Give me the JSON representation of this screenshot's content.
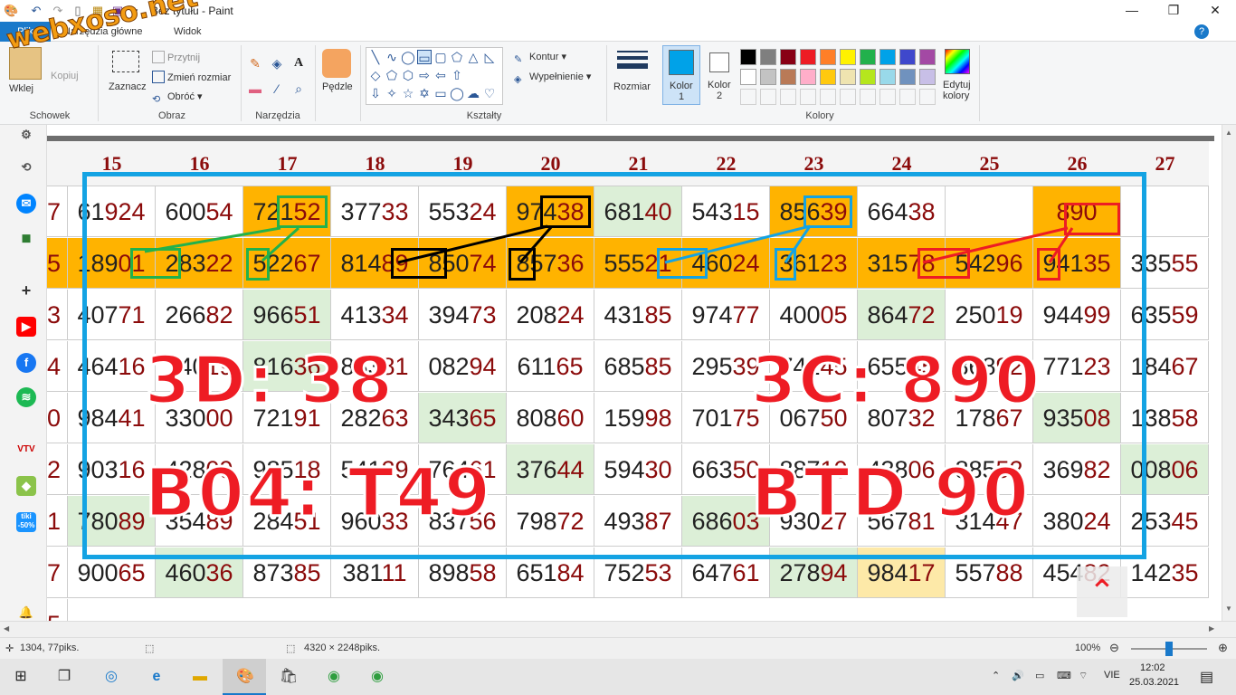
{
  "window": {
    "title": "Bez tytułu - Paint",
    "minimize": "—",
    "restore": "❐",
    "close": "✕"
  },
  "watermark": "webxoso.net",
  "menu": {
    "file": "Plik",
    "home": "Narzędzia główne",
    "view": "Widok",
    "help": "?"
  },
  "ribbon": {
    "clipboard": {
      "label": "Schowek",
      "paste": "Wklej",
      "copy": "Kopiuj"
    },
    "image": {
      "label": "Obraz",
      "select": "Zaznacz",
      "crop": "Przytnij",
      "resize": "Zmień rozmiar",
      "rotate": "Obróć"
    },
    "tools": {
      "label": "Narzędzia"
    },
    "brushes": {
      "label": "Pędzle"
    },
    "shapes": {
      "label": "Kształty",
      "outline": "Kontur",
      "fill": "Wypełnienie"
    },
    "size": {
      "label": "Rozmiar"
    },
    "color1": {
      "label": "Kolor",
      "num": "1"
    },
    "color2": {
      "label": "Kolor",
      "num": "2"
    },
    "edit_colors": {
      "label1": "Edytuj",
      "label2": "kolory"
    },
    "colors": {
      "label": "Kolory"
    },
    "palette_row1": [
      "#000000",
      "#7f7f7f",
      "#880015",
      "#ed1c24",
      "#ff7f27",
      "#fff200",
      "#22b14c",
      "#00a2e8",
      "#3f48cc",
      "#a349a4"
    ],
    "palette_row2": [
      "#ffffff",
      "#c3c3c3",
      "#b97a57",
      "#ffaec9",
      "#ffc90e",
      "#efe4b0",
      "#b5e61d",
      "#99d9ea",
      "#7092be",
      "#c8bfe7"
    ],
    "color1_value": "#00a2e8",
    "color2_value": "#ffffff"
  },
  "table": {
    "headers": [
      "15",
      "16",
      "17",
      "18",
      "19",
      "20",
      "21",
      "22",
      "23",
      "24",
      "25",
      "26",
      "27"
    ],
    "left_digits": [
      "7",
      "5",
      "3",
      "4",
      "0",
      "2",
      "1",
      "7",
      "5"
    ],
    "rows": [
      [
        [
          "61",
          "924",
          "",
          "orange_left_none"
        ],
        [
          "600",
          "54",
          ""
        ],
        [
          "721",
          "52",
          "orange"
        ],
        [
          "377",
          "33",
          ""
        ],
        [
          "553",
          "24",
          ""
        ],
        [
          "974",
          "38",
          "orange"
        ],
        [
          "681",
          "40",
          "green"
        ],
        [
          "543",
          "15",
          ""
        ],
        [
          "856",
          "39",
          "orange"
        ],
        [
          "664",
          "38",
          ""
        ],
        [
          "",
          "",
          ""
        ],
        [
          "",
          "890",
          "orange"
        ],
        [
          "",
          "",
          ""
        ]
      ],
      [
        [
          "189",
          "01",
          "orange"
        ],
        [
          "283",
          "22",
          "orange"
        ],
        [
          "522",
          "67",
          "orange"
        ],
        [
          "814",
          "89",
          "orange"
        ],
        [
          "850",
          "74",
          "orange"
        ],
        [
          "857",
          "36",
          "orange"
        ],
        [
          "555",
          "21",
          "orange"
        ],
        [
          "460",
          "24",
          "orange"
        ],
        [
          "361",
          "23",
          "orange"
        ],
        [
          "315",
          "78",
          "orange"
        ],
        [
          "542",
          "96",
          "orange"
        ],
        [
          "941",
          "35",
          "orange"
        ],
        [
          "335",
          "55",
          ""
        ]
      ],
      [
        [
          "407",
          "71",
          ""
        ],
        [
          "266",
          "82",
          ""
        ],
        [
          "966",
          "51",
          "green"
        ],
        [
          "413",
          "34",
          ""
        ],
        [
          "394",
          "73",
          ""
        ],
        [
          "208",
          "24",
          ""
        ],
        [
          "431",
          "85",
          ""
        ],
        [
          "974",
          "77",
          ""
        ],
        [
          "400",
          "05",
          ""
        ],
        [
          "864",
          "72",
          "green"
        ],
        [
          "250",
          "19",
          ""
        ],
        [
          "944",
          "99",
          ""
        ],
        [
          "635",
          "59",
          ""
        ]
      ],
      [
        [
          "464",
          "16",
          ""
        ],
        [
          "740",
          "19",
          ""
        ],
        [
          "816",
          "36",
          "green"
        ],
        [
          "883",
          "81",
          ""
        ],
        [
          "082",
          "94",
          ""
        ],
        [
          "611",
          "65",
          ""
        ],
        [
          "685",
          "85",
          ""
        ],
        [
          "295",
          "39",
          ""
        ],
        [
          "741",
          "45",
          ""
        ],
        [
          "655",
          "45",
          ""
        ],
        [
          "868",
          "92",
          ""
        ],
        [
          "771",
          "23",
          ""
        ],
        [
          "184",
          "67",
          ""
        ]
      ],
      [
        [
          "984",
          "41",
          ""
        ],
        [
          "330",
          "00",
          ""
        ],
        [
          "721",
          "91",
          ""
        ],
        [
          "282",
          "63",
          ""
        ],
        [
          "343",
          "65",
          "green"
        ],
        [
          "808",
          "60",
          ""
        ],
        [
          "159",
          "98",
          ""
        ],
        [
          "701",
          "75",
          ""
        ],
        [
          "067",
          "50",
          ""
        ],
        [
          "807",
          "32",
          ""
        ],
        [
          "178",
          "67",
          ""
        ],
        [
          "935",
          "08",
          "green"
        ],
        [
          "138",
          "58",
          ""
        ]
      ],
      [
        [
          "903",
          "16",
          ""
        ],
        [
          "428",
          "09",
          ""
        ],
        [
          "985",
          "18",
          ""
        ],
        [
          "541",
          "29",
          ""
        ],
        [
          "764",
          "61",
          ""
        ],
        [
          "376",
          "44",
          "green"
        ],
        [
          "594",
          "30",
          ""
        ],
        [
          "663",
          "50",
          ""
        ],
        [
          "887",
          "10",
          ""
        ],
        [
          "438",
          "06",
          ""
        ],
        [
          "885",
          "52",
          ""
        ],
        [
          "369",
          "82",
          ""
        ],
        [
          "008",
          "06",
          "green"
        ]
      ],
      [
        [
          "780",
          "89",
          "green"
        ],
        [
          "354",
          "89",
          ""
        ],
        [
          "284",
          "51",
          ""
        ],
        [
          "960",
          "33",
          ""
        ],
        [
          "837",
          "56",
          ""
        ],
        [
          "798",
          "72",
          ""
        ],
        [
          "493",
          "87",
          ""
        ],
        [
          "686",
          "03",
          "green"
        ],
        [
          "930",
          "27",
          ""
        ],
        [
          "567",
          "81",
          ""
        ],
        [
          "314",
          "47",
          ""
        ],
        [
          "380",
          "24",
          ""
        ],
        [
          "253",
          "45",
          ""
        ]
      ],
      [
        [
          "900",
          "65",
          ""
        ],
        [
          "460",
          "36",
          "green"
        ],
        [
          "873",
          "85",
          ""
        ],
        [
          "381",
          "11",
          ""
        ],
        [
          "898",
          "58",
          ""
        ],
        [
          "651",
          "84",
          ""
        ],
        [
          "752",
          "53",
          ""
        ],
        [
          "647",
          "61",
          ""
        ],
        [
          "278",
          "94",
          "green"
        ],
        [
          "984",
          "17",
          "yellow"
        ],
        [
          "557",
          "88",
          ""
        ],
        [
          "454",
          "82",
          ""
        ],
        [
          "142",
          "35",
          ""
        ]
      ]
    ]
  },
  "overlay": {
    "text_3d": "3D: 38",
    "text_3c": "3C: 890",
    "text_b04": "B04: T49",
    "text_btd": "BTD 90"
  },
  "status": {
    "cursor": "1304, 77piks.",
    "selection": "",
    "size": "4320 × 2248piks.",
    "zoom": "100%"
  },
  "taskbar": {
    "lang": "VIE",
    "time": "12:02",
    "date": "25.03.2021"
  },
  "sidebar_badge": "-50%"
}
